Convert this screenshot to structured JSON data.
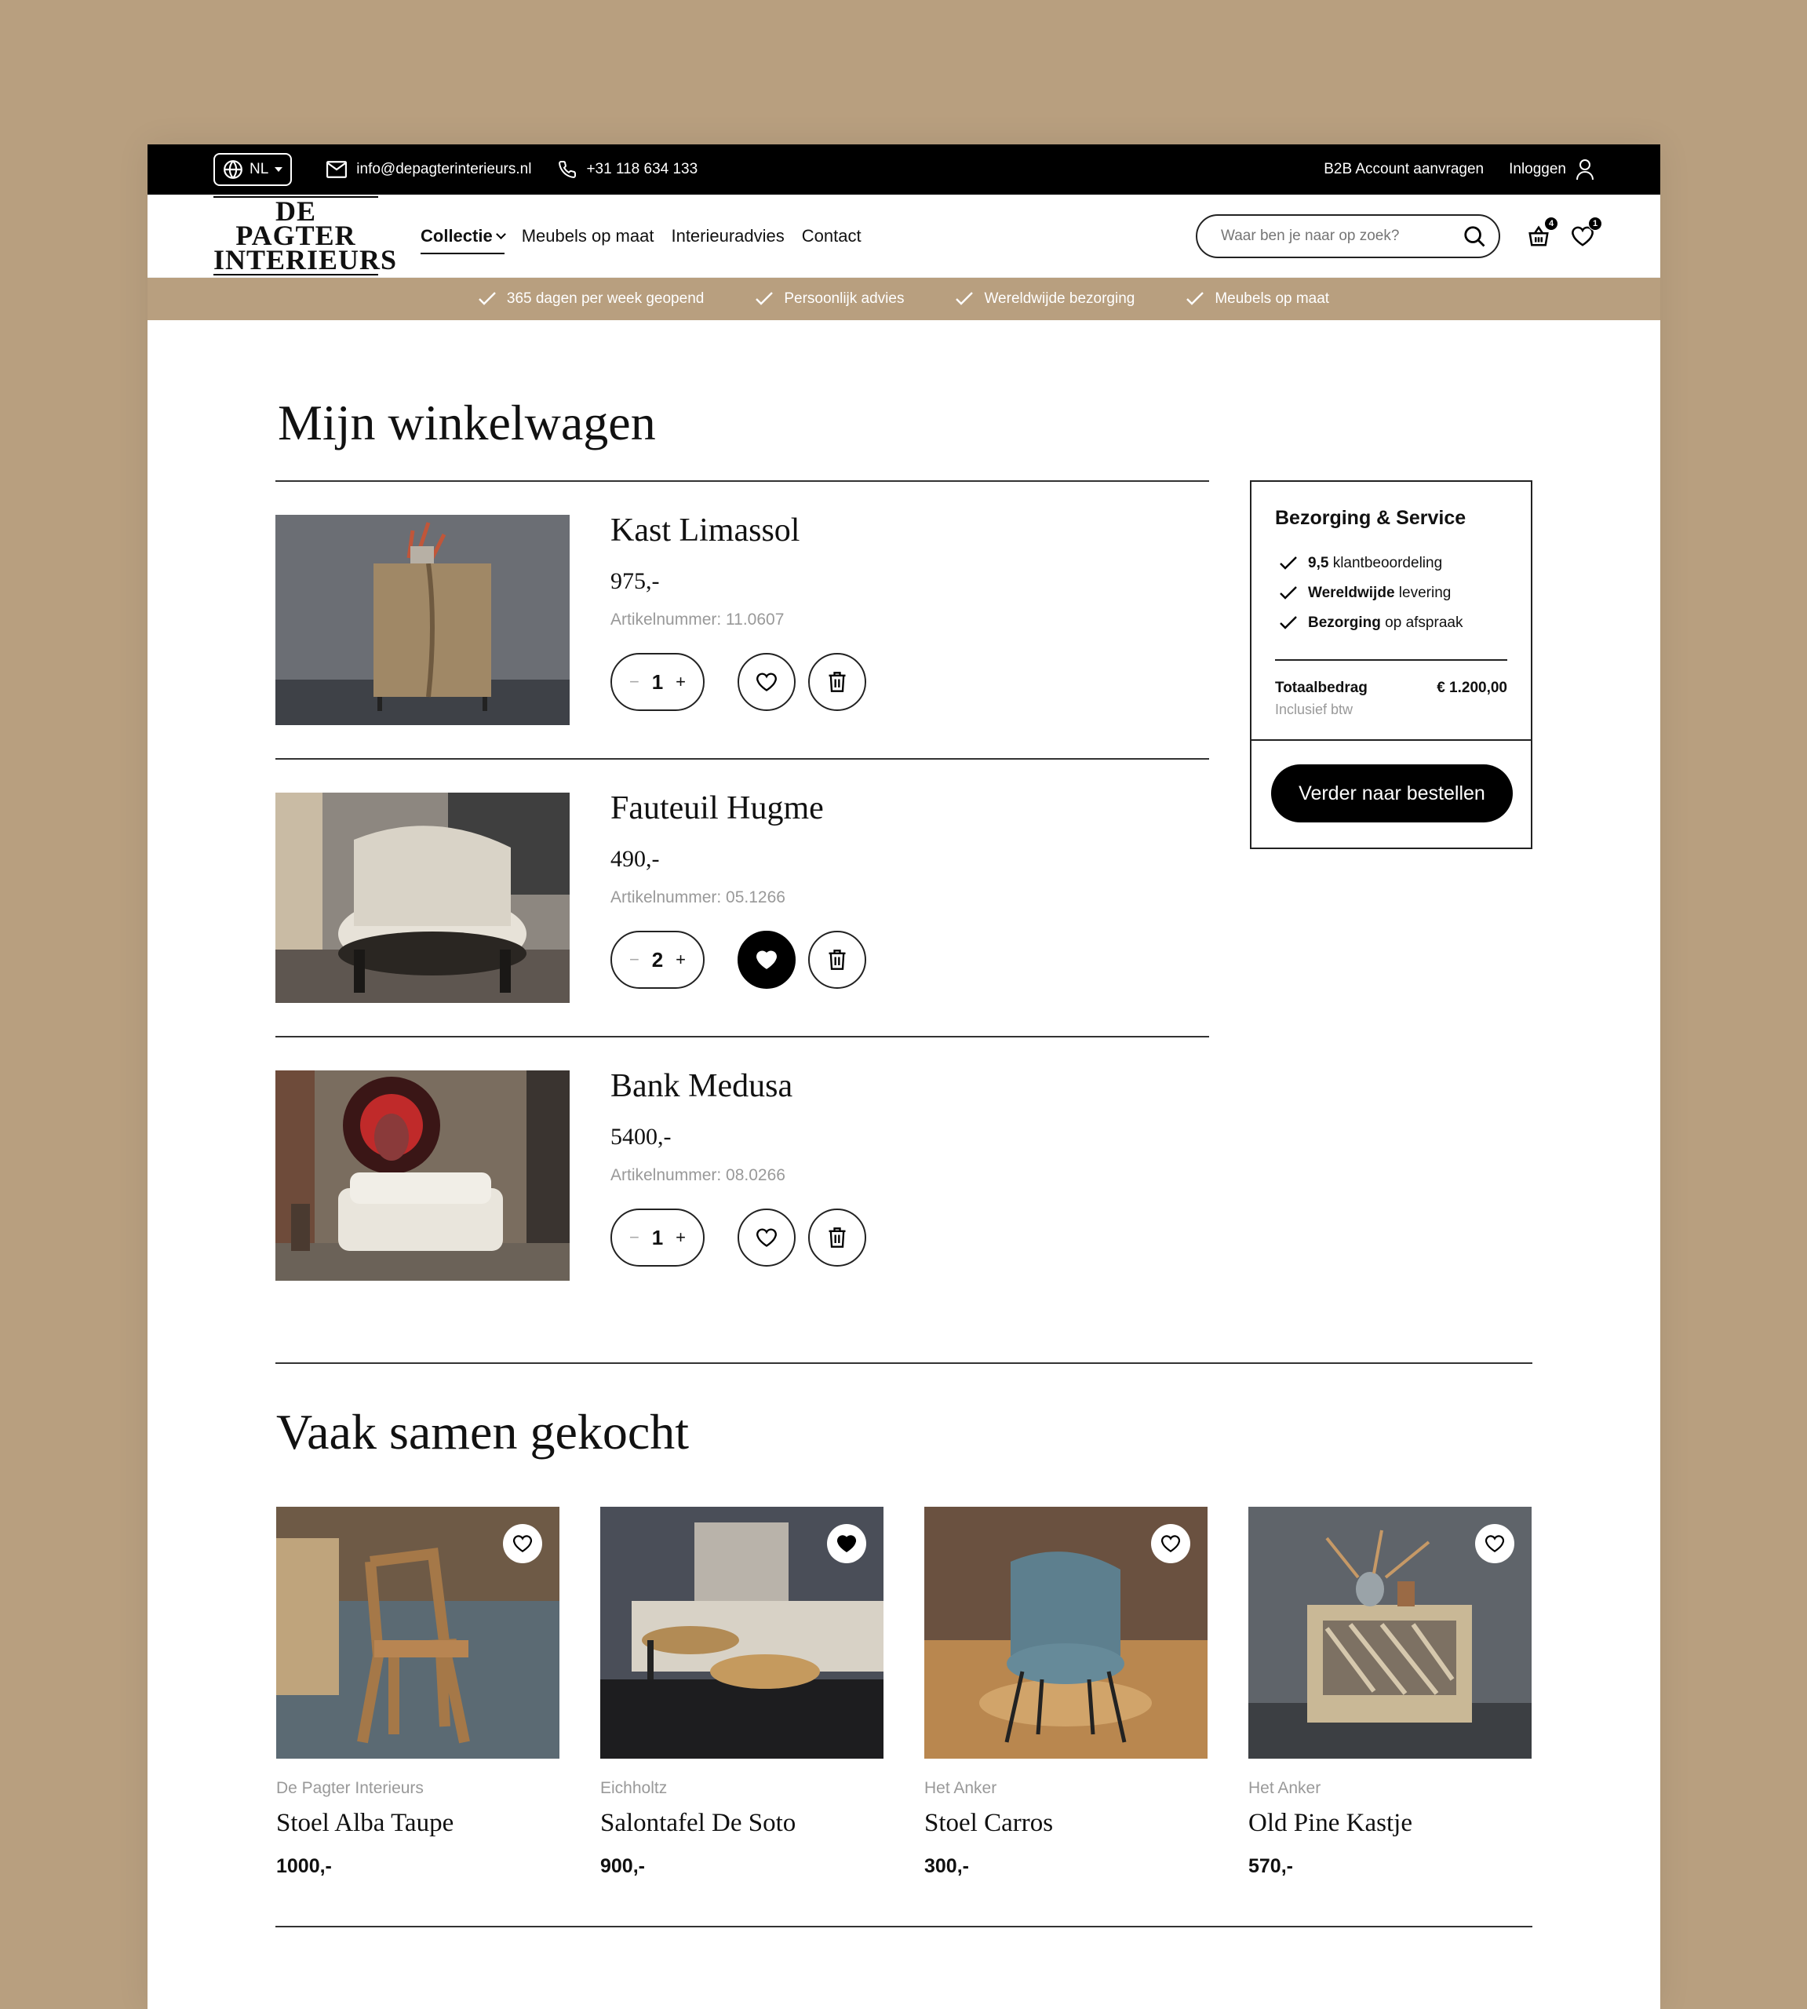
{
  "topbar": {
    "lang": "NL",
    "email": "info@depagterinterieurs.nl",
    "phone": "+31 118 634 133",
    "b2b": "B2B Account aanvragen",
    "login": "Inloggen"
  },
  "header": {
    "logo_line1": "DE PAGTER",
    "logo_line2": "INTERIEURS",
    "nav": [
      "Collectie",
      "Meubels op maat",
      "Interieuradvies",
      "Contact"
    ],
    "search_placeholder": "Waar ben je naar op zoek?",
    "cart_count": "4",
    "wishlist_count": "1"
  },
  "usp": [
    "365 dagen per week geopend",
    "Persoonlijk advies",
    "Wereldwijde bezorging",
    "Meubels op maat"
  ],
  "cart": {
    "title": "Mijn winkelwagen",
    "items": [
      {
        "name": "Kast Limassol",
        "price": "975,-",
        "sku": "Artikelnummer: 11.0607",
        "qty": "1",
        "favorite": false
      },
      {
        "name": "Fauteuil Hugme",
        "price": "490,-",
        "sku": "Artikelnummer: 05.1266",
        "qty": "2",
        "favorite": true
      },
      {
        "name": "Bank Medusa",
        "price": "5400,-",
        "sku": "Artikelnummer: 08.0266",
        "qty": "1",
        "favorite": false
      }
    ]
  },
  "summary": {
    "title": "Bezorging & Service",
    "checks": [
      {
        "bold": "9,5",
        "rest": " klantbeoordeling"
      },
      {
        "bold": "Wereldwijde",
        "rest": " levering"
      },
      {
        "bold": "Bezorging",
        "rest": " op afspraak"
      }
    ],
    "total_label": "Totaalbedrag",
    "total_value": "€ 1.200,00",
    "incl": "Inclusief btw",
    "button": "Verder naar bestellen"
  },
  "related": {
    "title": "Vaak samen gekocht",
    "products": [
      {
        "brand": "De Pagter Interieurs",
        "name": "Stoel Alba Taupe",
        "price": "1000,-",
        "favorite": false
      },
      {
        "brand": "Eichholtz",
        "name": "Salontafel De Soto",
        "price": "900,-",
        "favorite": true
      },
      {
        "brand": "Het Anker",
        "name": "Stoel Carros",
        "price": "300,-",
        "favorite": false
      },
      {
        "brand": "Het Anker",
        "name": "Old Pine Kastje",
        "price": "570,-",
        "favorite": false
      }
    ]
  },
  "colors": {
    "accent": "#b89f7f",
    "dark": "#000000"
  }
}
